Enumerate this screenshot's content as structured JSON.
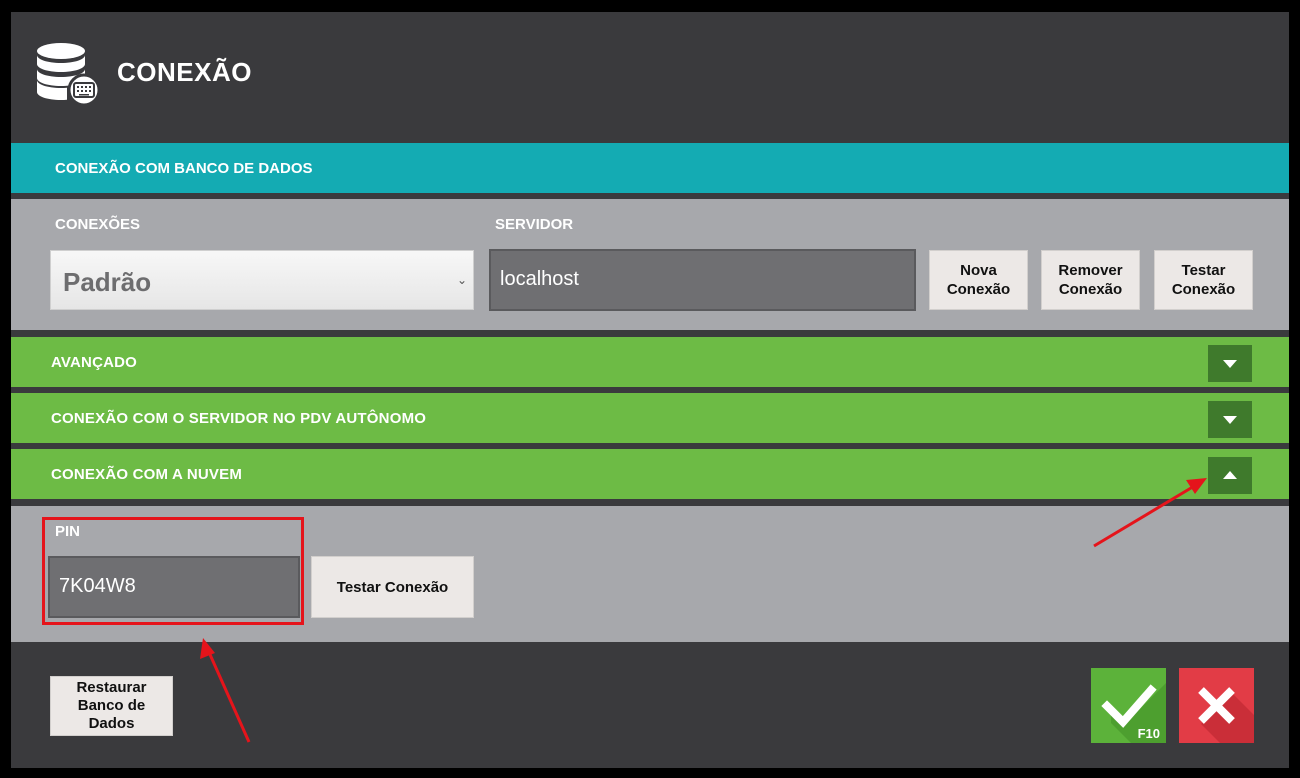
{
  "window": {
    "title": "CONEXÃO",
    "icon": "database-keyboard-icon"
  },
  "db_section": {
    "header": "CONEXÃO COM BANCO DE DADOS",
    "connections_label": "CONEXÕES",
    "connections_selected": "Padrão",
    "server_label": "SERVIDOR",
    "server_value": "localhost",
    "buttons": {
      "new_line1": "Nova",
      "new_line2": "Conexão",
      "remove_line1": "Remover",
      "remove_line2": "Conexão",
      "test_line1": "Testar",
      "test_line2": "Conexão"
    }
  },
  "accordions": [
    {
      "label": "AVANÇADO",
      "expanded": false
    },
    {
      "label": "CONEXÃO COM O SERVIDOR NO PDV AUTÔNOMO",
      "expanded": false
    },
    {
      "label": "CONEXÃO COM A NUVEM",
      "expanded": true
    }
  ],
  "cloud": {
    "pin_label": "PIN",
    "pin_value": "7K04W8",
    "test_button": "Testar Conexão"
  },
  "footer": {
    "restore_line1": "Restaurar",
    "restore_line2": "Banco de",
    "restore_line3": "Dados",
    "ok_shortcut": "F10",
    "ok_icon": "check-icon",
    "cancel_icon": "close-icon"
  },
  "colors": {
    "teal": "#14abb3",
    "green": "#6dbb45",
    "dark_green": "#3f7a2c",
    "ok_green": "#5cb23a",
    "cancel_red": "#e23c46",
    "annotation_red": "#e5141b"
  }
}
